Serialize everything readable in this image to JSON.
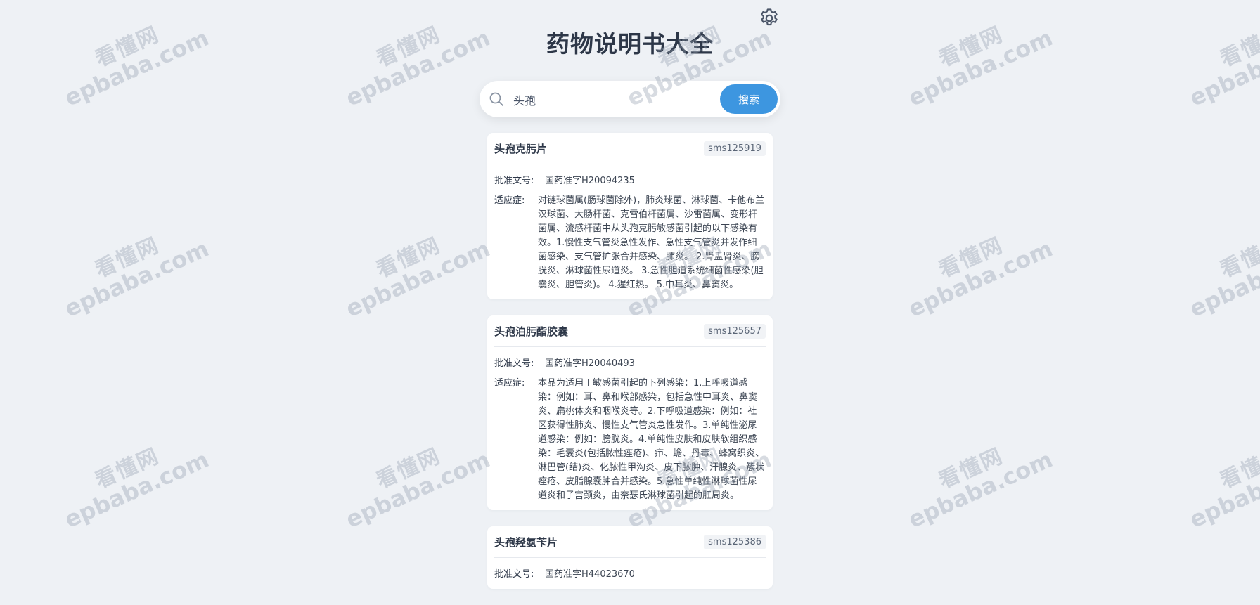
{
  "app": {
    "title": "药物说明书大全"
  },
  "icons": {
    "settings": "gear-icon",
    "search": "search-icon"
  },
  "colors": {
    "background": "#eef1f5",
    "accent": "#3d96e0",
    "title": "#2d3748"
  },
  "search": {
    "value": "头孢",
    "button_label": "搜索"
  },
  "labels": {
    "approval": "批准文号:",
    "indication": "适应症:"
  },
  "results": [
    {
      "name": "头孢克肟片",
      "code": "sms125919",
      "approval": "国药准字H20094235",
      "indication": "对链球菌属(肠球菌除外)，肺炎球菌、淋球菌、卡他布兰汉球菌、大肠杆菌、克雷伯杆菌属、沙雷菌属、变形杆菌属、流感杆菌中从头孢克肟敏感菌引起的以下感染有效。1.慢性支气管炎急性发作、急性支气管炎并发作细菌感染、支气管扩张合并感染、肺炎。 2.肾盂肾炎、膀胱炎、淋球菌性尿道炎。 3.急性胆道系统细菌性感染(胆囊炎、胆管炎)。 4.猩红热。 5.中耳炎、鼻窦炎。"
    },
    {
      "name": "头孢泊肟酯胶囊",
      "code": "sms125657",
      "approval": "国药准字H20040493",
      "indication": "本品为适用于敏感菌引起的下列感染：1.上呼吸道感染：例如：耳、鼻和喉部感染，包括急性中耳炎、鼻窦炎、扁桃体炎和咽喉炎等。2.下呼吸道感染：例如：社区获得性肺炎、慢性支气管炎急性发作。3.单纯性泌尿道感染：例如：膀胱炎。4.单纯性皮肤和皮肤软组织感染：毛囊炎(包括脓性痤疮)、疖、蟾、丹毒、蜂窝织炎、淋巴管(结)炎、化脓性甲沟炎、皮下脓肿、汗腺炎、簇状痤疮、皮脂腺囊肿合并感染。5.急性单纯性淋球菌性尿道炎和子宫颈炎，由奈瑟氏淋球菌引起的肛周炎。"
    },
    {
      "name": "头孢羟氨苄片",
      "code": "sms125386",
      "approval": "国药准字H44023670",
      "indication": ""
    }
  ],
  "watermark": {
    "line1": "看懂网",
    "line2": "epbaba.com"
  }
}
